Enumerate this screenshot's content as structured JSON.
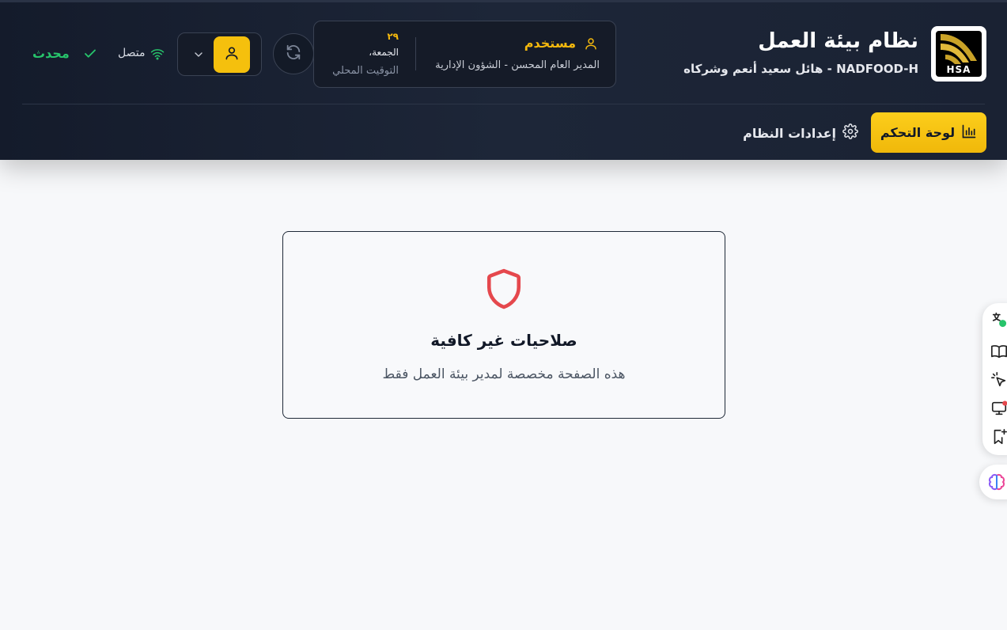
{
  "app": {
    "title": "نظام بيئة العمل",
    "subtitle": "NADFOOD-H - هائل سعيد أنعم وشركاه",
    "logo_text": "HSA"
  },
  "user_panel": {
    "role": "مستخدم",
    "description": "المدير العام المحسن - الشؤون الإدارية",
    "date_day": "٢٩",
    "weekday": "الجمعة،",
    "timezone_label": "التوقيت المحلي"
  },
  "status": {
    "connection": "متصل",
    "sync": "محدث"
  },
  "nav": {
    "dashboard": "لوحة التحكم",
    "settings": "إعدادات النظام"
  },
  "card": {
    "title": "صلاحيات غير كافية",
    "message": "هذه الصفحة مخصصة لمدير بيئة العمل فقط"
  },
  "colors": {
    "accent": "#f5c00d",
    "header_bg": "#1a2233",
    "success": "#27c46b",
    "danger": "#e5484d"
  },
  "icons": {
    "user": "user-icon",
    "refresh": "refresh-icon",
    "chevron": "chevron-down-icon",
    "wifi": "wifi-icon",
    "check": "check-icon",
    "chart": "bar-chart-icon",
    "gear": "gear-icon",
    "shield": "shield-icon"
  }
}
